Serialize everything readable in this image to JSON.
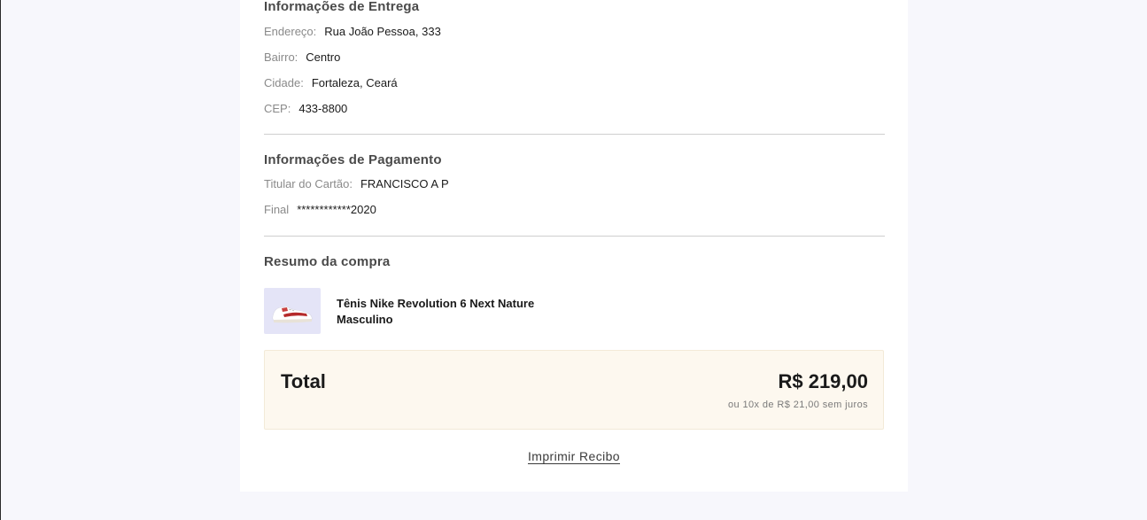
{
  "delivery": {
    "title": "Informações de Entrega",
    "address_label": "Endereço:",
    "address_value": "Rua João Pessoa, 333",
    "district_label": "Bairro:",
    "district_value": "Centro",
    "city_label": "Cidade:",
    "city_value": "Fortaleza, Ceará",
    "zip_label": "CEP:",
    "zip_value": "433-8800"
  },
  "payment": {
    "title": "Informações de Pagamento",
    "holder_label": "Titular do Cartão:",
    "holder_value": "FRANCISCO A P",
    "final_label": "Final",
    "final_value": "************2020"
  },
  "summary": {
    "title": "Resumo da compra",
    "product_name": "Tênis Nike Revolution 6 Next Nature Masculino",
    "product_image_icon": "sneaker-icon"
  },
  "total": {
    "label": "Total",
    "amount": "R$ 219,00",
    "installments": "ou 10x de R$ 21,00 sem juros"
  },
  "actions": {
    "print_label": "Imprimir Recibo"
  },
  "colors": {
    "page_bg": "#f7f7fc",
    "card_bg": "#ffffff",
    "total_bg": "#fdf8ef",
    "thumb_bg": "#e4e4f7"
  }
}
